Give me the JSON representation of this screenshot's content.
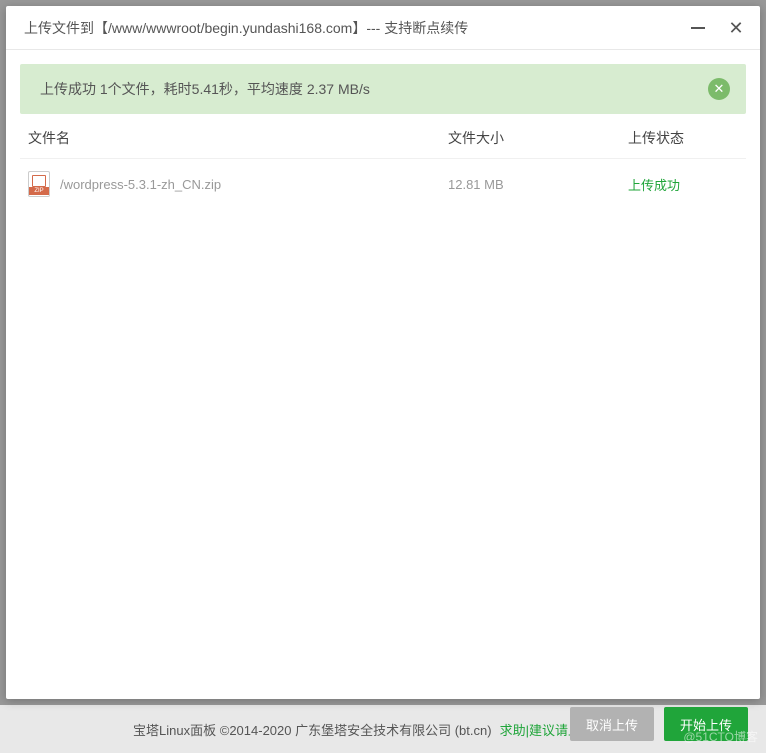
{
  "dialog": {
    "title": "上传文件到【/www/wwwroot/begin.yundashi168.com】--- 支持断点续传"
  },
  "banner": {
    "message": "上传成功 1个文件，耗时5.41秒，平均速度 2.37 MB/s"
  },
  "columns": {
    "name": "文件名",
    "size": "文件大小",
    "status": "上传状态"
  },
  "files": [
    {
      "name": "/wordpress-5.3.1-zh_CN.zip",
      "size": "12.81 MB",
      "status": "上传成功"
    }
  ],
  "buttons": {
    "cancel": "取消上传",
    "start": "开始上传"
  },
  "footer": {
    "text": "宝塔Linux面板 ©2014-2020 广东堡塔安全技术有限公司 (bt.cn)",
    "link1": "求助|建议请上宝塔论坛"
  },
  "watermark": "@51CTO博客"
}
